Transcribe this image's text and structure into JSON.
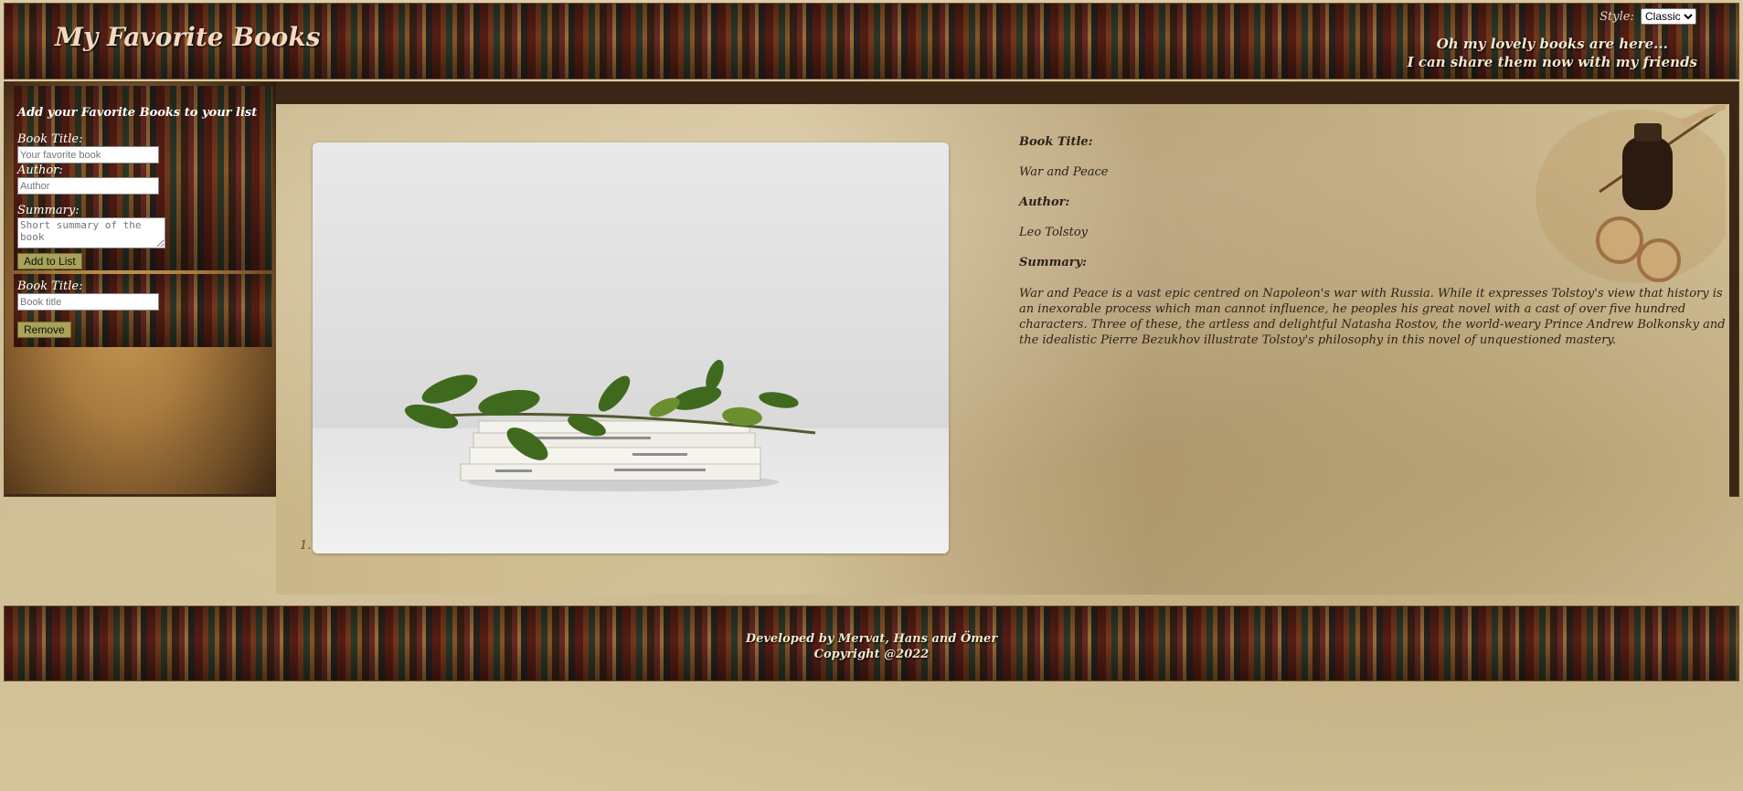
{
  "header": {
    "title": "My Favorite Books",
    "style_label": "Style:",
    "style_selected": "Classic",
    "tagline_line1": "Oh my lovely books are here...",
    "tagline_line2": "I can share them now with my friends"
  },
  "add_form": {
    "heading": "Add your Favorite Books to your list",
    "title_label": "Book Title:",
    "title_placeholder": "Your favorite book",
    "author_label": "Author:",
    "author_placeholder": "Author",
    "summary_label": "Summary:",
    "summary_placeholder": "Short summary of the book",
    "add_button": "Add to List"
  },
  "remove_form": {
    "title_label": "Book Title:",
    "title_placeholder": "Book title",
    "remove_button": "Remove"
  },
  "book_list": {
    "items": [
      {
        "number": "1."
      }
    ]
  },
  "detail": {
    "title_heading": "Book Title:",
    "title_value": "War and Peace",
    "author_heading": "Author:",
    "author_value": "Leo Tolstoy",
    "summary_heading": "Summary:",
    "summary_value": "War and Peace is a vast epic centred on Napoleon's war with Russia. While it expresses Tolstoy's view that history is an inexorable process which man cannot influence, he peoples his great novel with a cast of over five hundred characters. Three of these, the artless and delightful Natasha Rostov, the world-weary Prince Andrew Bolkonsky and the idealistic Pierre Bezukhov illustrate Tolstoy's philosophy in this novel of unquestioned mastery."
  },
  "footer": {
    "line1": "Developed by Mervat, Hans and Ömer",
    "line2": "Copyright @2022"
  }
}
